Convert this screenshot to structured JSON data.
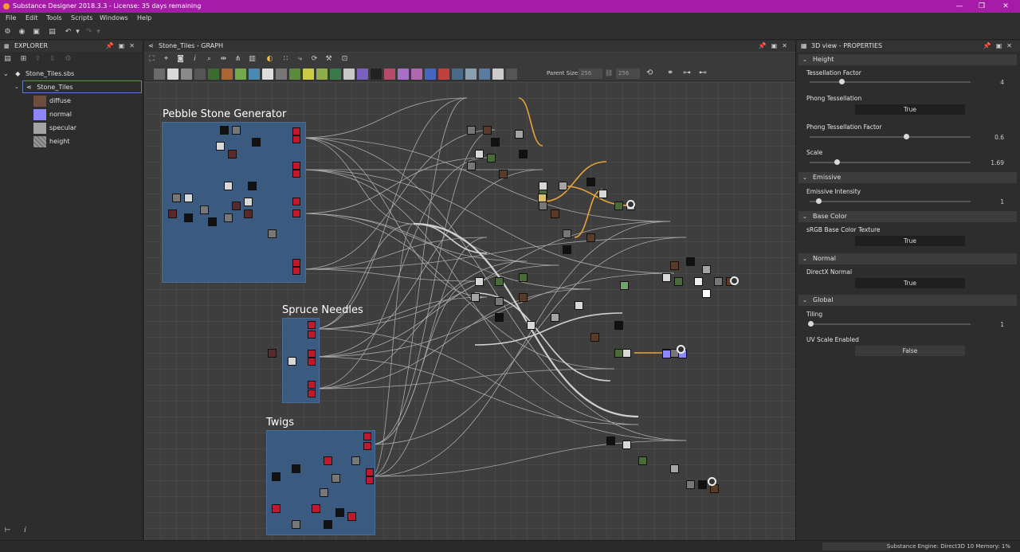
{
  "app": {
    "title": "Substance Designer 2018.3.3 - License: 35 days remaining"
  },
  "menu": [
    "File",
    "Edit",
    "Tools",
    "Scripts",
    "Windows",
    "Help"
  ],
  "explorer": {
    "title": "EXPLORER",
    "package": "Stone_Tiles.sbs",
    "graph": "Stone_Tiles",
    "outputs": [
      {
        "label": "diffuse",
        "color": "#6e4d3e"
      },
      {
        "label": "normal",
        "color": "#8c86ff"
      },
      {
        "label": "specular",
        "color": "#a4a4a4"
      },
      {
        "label": "height",
        "color": "#8a8a8a"
      }
    ]
  },
  "graph": {
    "title": "Stone_Tiles - GRAPH",
    "parent_size_label": "Parent Size:",
    "parent_size": "256",
    "size": "256",
    "frames": [
      {
        "title": "Pebble Stone Generator"
      },
      {
        "title": "Spruce Needles"
      },
      {
        "title": "Twigs"
      }
    ]
  },
  "properties": {
    "title": "3D view - PROPERTIES",
    "sections": [
      {
        "name": "Height"
      },
      {
        "name": "Emissive"
      },
      {
        "name": "Base Color"
      },
      {
        "name": "Normal"
      },
      {
        "name": "Global"
      }
    ],
    "tessellation_factor": {
      "label": "Tessellation Factor",
      "value": "4",
      "fraction": 0.2
    },
    "phong_tessellation": {
      "label": "Phong Tessellation",
      "value": "True"
    },
    "phong_tessellation_factor": {
      "label": "Phong Tessellation Factor",
      "value": "0.6",
      "fraction": 0.6
    },
    "scale": {
      "label": "Scale",
      "value": "1.69",
      "fraction": 0.17
    },
    "emissive_intensity": {
      "label": "Emissive Intensity",
      "value": "1",
      "fraction": 0.05
    },
    "srgb_base_color": {
      "label": "sRGB Base Color Texture",
      "value": "True"
    },
    "directx_normal": {
      "label": "DirectX Normal",
      "value": "True"
    },
    "tiling": {
      "label": "Tiling",
      "value": "1",
      "fraction": 0.0
    },
    "uv_scale_enabled": {
      "label": "UV Scale Enabled",
      "value": "False"
    }
  },
  "status": {
    "text": "Substance Engine: Direct3D 10   Memory: 1%"
  },
  "colors": {
    "titlebar": "#a61ca8",
    "frame": "#3a5a80",
    "node_red": "#c0182c",
    "connection_orange": "#e8a23a"
  }
}
